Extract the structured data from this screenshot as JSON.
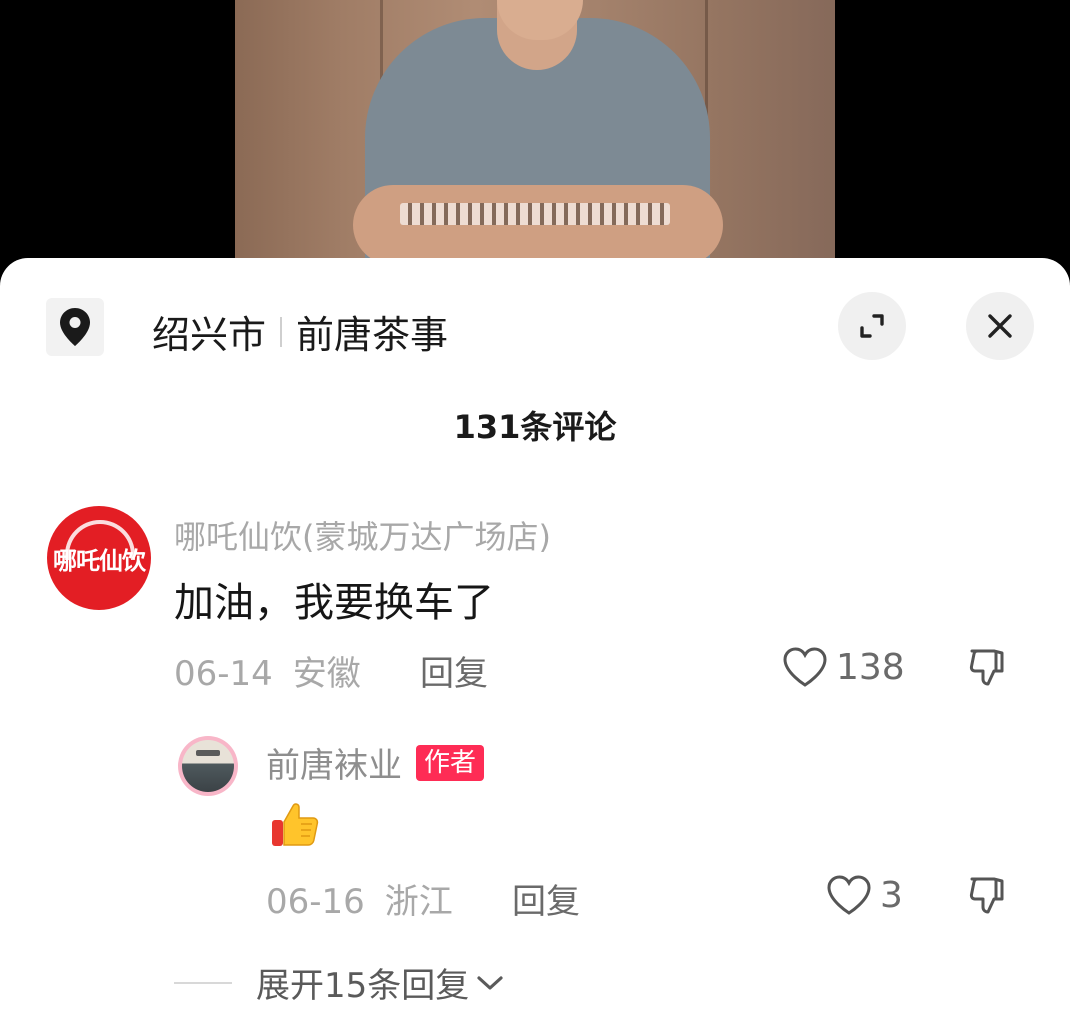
{
  "header": {
    "city": "绍兴市",
    "place": "前唐茶事",
    "comment_count": "131条评论"
  },
  "comments": [
    {
      "avatar_text": "哪吒仙饮",
      "username": "哪吒仙饮(蒙城万达广场店)",
      "text": "加油，我要换车了",
      "date": "06-14",
      "location": "安徽",
      "reply_label": "回复",
      "likes": "138"
    }
  ],
  "reply": {
    "username": "前唐袜业",
    "badge": "作者",
    "emoji": "thumbs-up",
    "date": "06-16",
    "location": "浙江",
    "reply_label": "回复",
    "likes": "3"
  },
  "expand_label": "展开15条回复",
  "colors": {
    "accent": "#fe2c55",
    "avatar_red": "#e31e24"
  }
}
